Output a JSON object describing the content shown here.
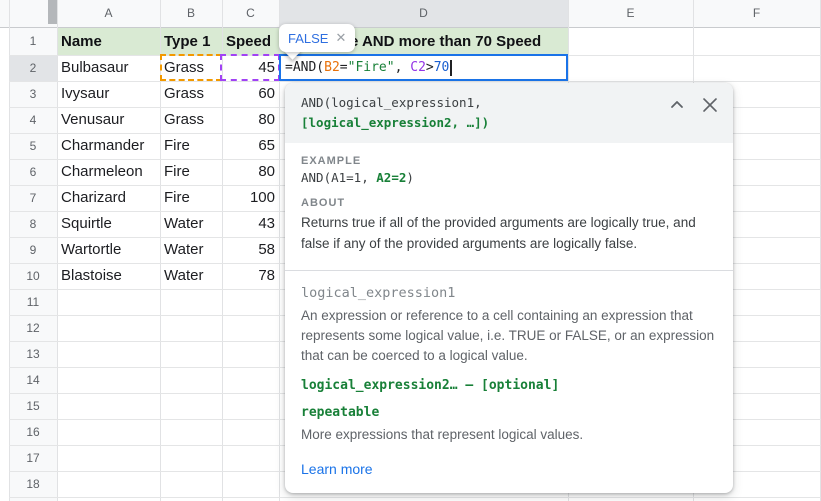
{
  "sheet": {
    "column_letters": [
      "A",
      "B",
      "C",
      "D",
      "E",
      "F"
    ],
    "row_numbers": [
      "1",
      "2",
      "3",
      "4",
      "5",
      "6",
      "7",
      "8",
      "9",
      "10",
      "11",
      "12",
      "13",
      "14",
      "15",
      "16",
      "17",
      "18"
    ],
    "header_row": {
      "name": "Name",
      "type": "Type 1",
      "speed": "Speed",
      "d_visible": "e AND more than 70 Speed"
    },
    "rows": [
      {
        "name": "Bulbasaur",
        "type": "Grass",
        "speed": "45"
      },
      {
        "name": "Ivysaur",
        "type": "Grass",
        "speed": "60"
      },
      {
        "name": "Venusaur",
        "type": "Grass",
        "speed": "80"
      },
      {
        "name": "Charmander",
        "type": "Fire",
        "speed": "65"
      },
      {
        "name": "Charmeleon",
        "type": "Fire",
        "speed": "80"
      },
      {
        "name": "Charizard",
        "type": "Fire",
        "speed": "100"
      },
      {
        "name": "Squirtle",
        "type": "Water",
        "speed": "43"
      },
      {
        "name": "Wartortle",
        "type": "Water",
        "speed": "58"
      },
      {
        "name": "Blastoise",
        "type": "Water",
        "speed": "78"
      }
    ]
  },
  "edit": {
    "result_chip": {
      "value": "FALSE",
      "close": "✕"
    },
    "formula": {
      "t_fn": "=AND(",
      "t_ref1": "B2",
      "t_op1": "=",
      "t_str": "\"Fire\"",
      "t_comma": ", ",
      "t_ref2": "C2",
      "t_op2": ">",
      "t_num": "70"
    }
  },
  "popup": {
    "signature_line1": "AND(logical_expression1,",
    "signature_line2": "[logical_expression2, …])",
    "example_label": "EXAMPLE",
    "example_pre": "AND(A1=1, ",
    "example_highlight": "A2=2",
    "example_post": ")",
    "about_label": "ABOUT",
    "about_text": "Returns true if all of the provided arguments are logically true, and false if any of the provided arguments are logically false.",
    "param1_name": "logical_expression1",
    "param1_desc": "An expression or reference to a cell containing an expression that represents some logical value, i.e. TRUE or FALSE, or an expression that can be coerced to a logical value.",
    "param2_line": "logical_expression2… – [optional]",
    "repeatable_label": "repeatable",
    "repeatable_desc": "More expressions that represent logical values.",
    "learn_more": "Learn more"
  },
  "colors": {
    "accent_blue": "#1a73e8",
    "doc_green": "#188038",
    "ref_orange": "#f29900",
    "ref_purple": "#a142f4",
    "number_blue": "#1a5fd0",
    "header_green": "#d9ead3"
  }
}
